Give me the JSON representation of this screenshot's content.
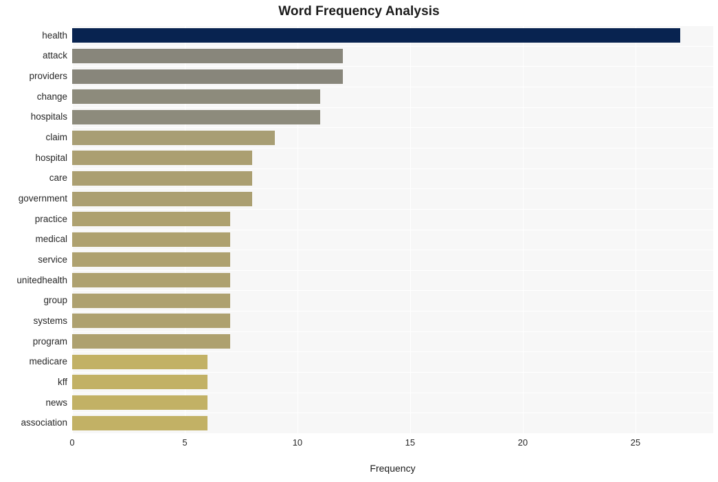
{
  "chart_data": {
    "type": "bar",
    "orientation": "horizontal",
    "title": "Word Frequency Analysis",
    "xlabel": "Frequency",
    "ylabel": "",
    "categories": [
      "health",
      "attack",
      "providers",
      "change",
      "hospitals",
      "claim",
      "hospital",
      "care",
      "government",
      "practice",
      "medical",
      "service",
      "unitedhealth",
      "group",
      "systems",
      "program",
      "medicare",
      "kff",
      "news",
      "association"
    ],
    "values": [
      27,
      12,
      12,
      11,
      11,
      9,
      8,
      8,
      8,
      7,
      7,
      7,
      7,
      7,
      7,
      7,
      6,
      6,
      6,
      6
    ],
    "bar_colors": [
      "#082350",
      "#88867b",
      "#88867b",
      "#8d8b7c",
      "#8d8b7c",
      "#a89e74",
      "#ab9f71",
      "#ab9f71",
      "#ab9f71",
      "#aea16f",
      "#aea16f",
      "#aea16f",
      "#aea16f",
      "#aea16f",
      "#aea16f",
      "#aea16f",
      "#c2b165",
      "#c2b165",
      "#c2b165",
      "#c2b165"
    ],
    "xlim": [
      0,
      28.45
    ],
    "xticks": [
      0,
      5,
      10,
      15,
      20,
      25
    ],
    "xtick_labels": [
      "0",
      "5",
      "10",
      "15",
      "20",
      "25"
    ],
    "grid": true,
    "grid_color": "#ffffff",
    "plot_background": "#f7f7f7",
    "figure_background": "#ffffff",
    "legend": "none"
  }
}
